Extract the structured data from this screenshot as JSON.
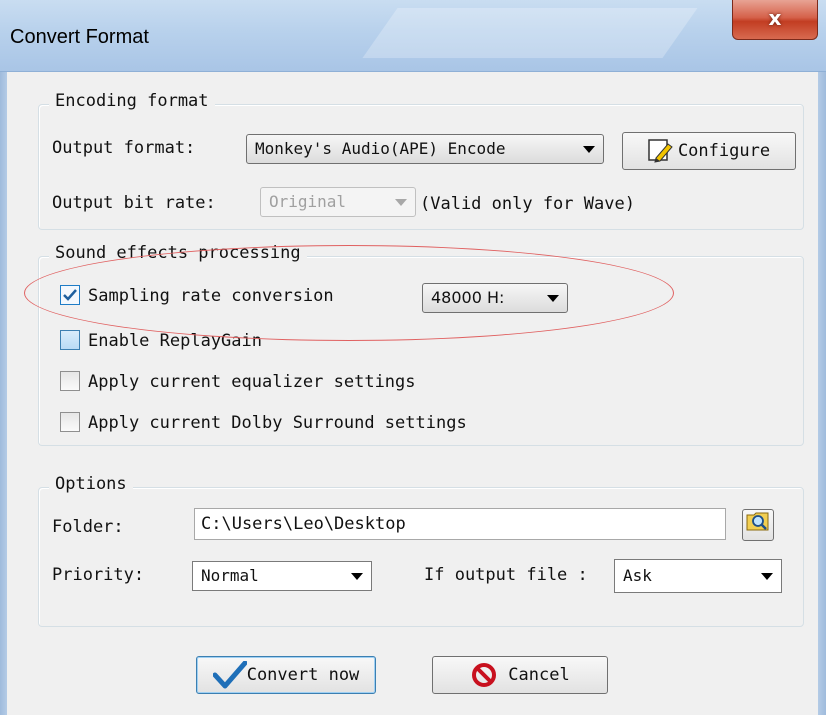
{
  "window": {
    "title": "Convert Format",
    "close_label": "x"
  },
  "encoding": {
    "legend": "Encoding format",
    "output_format_label": "Output format:",
    "output_format_value": "Monkey's Audio(APE) Encode",
    "configure_label": "Configure",
    "bit_rate_label": "Output bit rate:",
    "bit_rate_value": "Original",
    "bit_rate_note": "(Valid only for Wave)"
  },
  "sound_effects": {
    "legend": "Sound effects processing",
    "sampling_label": "Sampling rate conversion",
    "sampling_checked": true,
    "sampling_value": "48000 H:",
    "replaygain_label": "Enable ReplayGain",
    "replaygain_checked": false,
    "equalizer_label": "Apply current equalizer settings",
    "equalizer_checked": false,
    "dolby_label": "Apply current Dolby Surround settings",
    "dolby_checked": false
  },
  "options": {
    "legend": "Options",
    "folder_label": "Folder:",
    "folder_value": "C:\\Users\\Leo\\Desktop",
    "priority_label": "Priority:",
    "priority_value": "Normal",
    "if_output_label": "If output file :",
    "if_output_value": "Ask"
  },
  "buttons": {
    "convert_label": "Convert now",
    "cancel_label": "Cancel"
  },
  "colors": {
    "annotation_ellipse": "#e06060",
    "checkbox_accent": "#1e7cc6"
  },
  "icons": {
    "configure": "edit-pencil-icon",
    "folder_browse": "folder-search-icon",
    "convert": "checkmark-icon",
    "cancel": "prohibited-icon"
  }
}
